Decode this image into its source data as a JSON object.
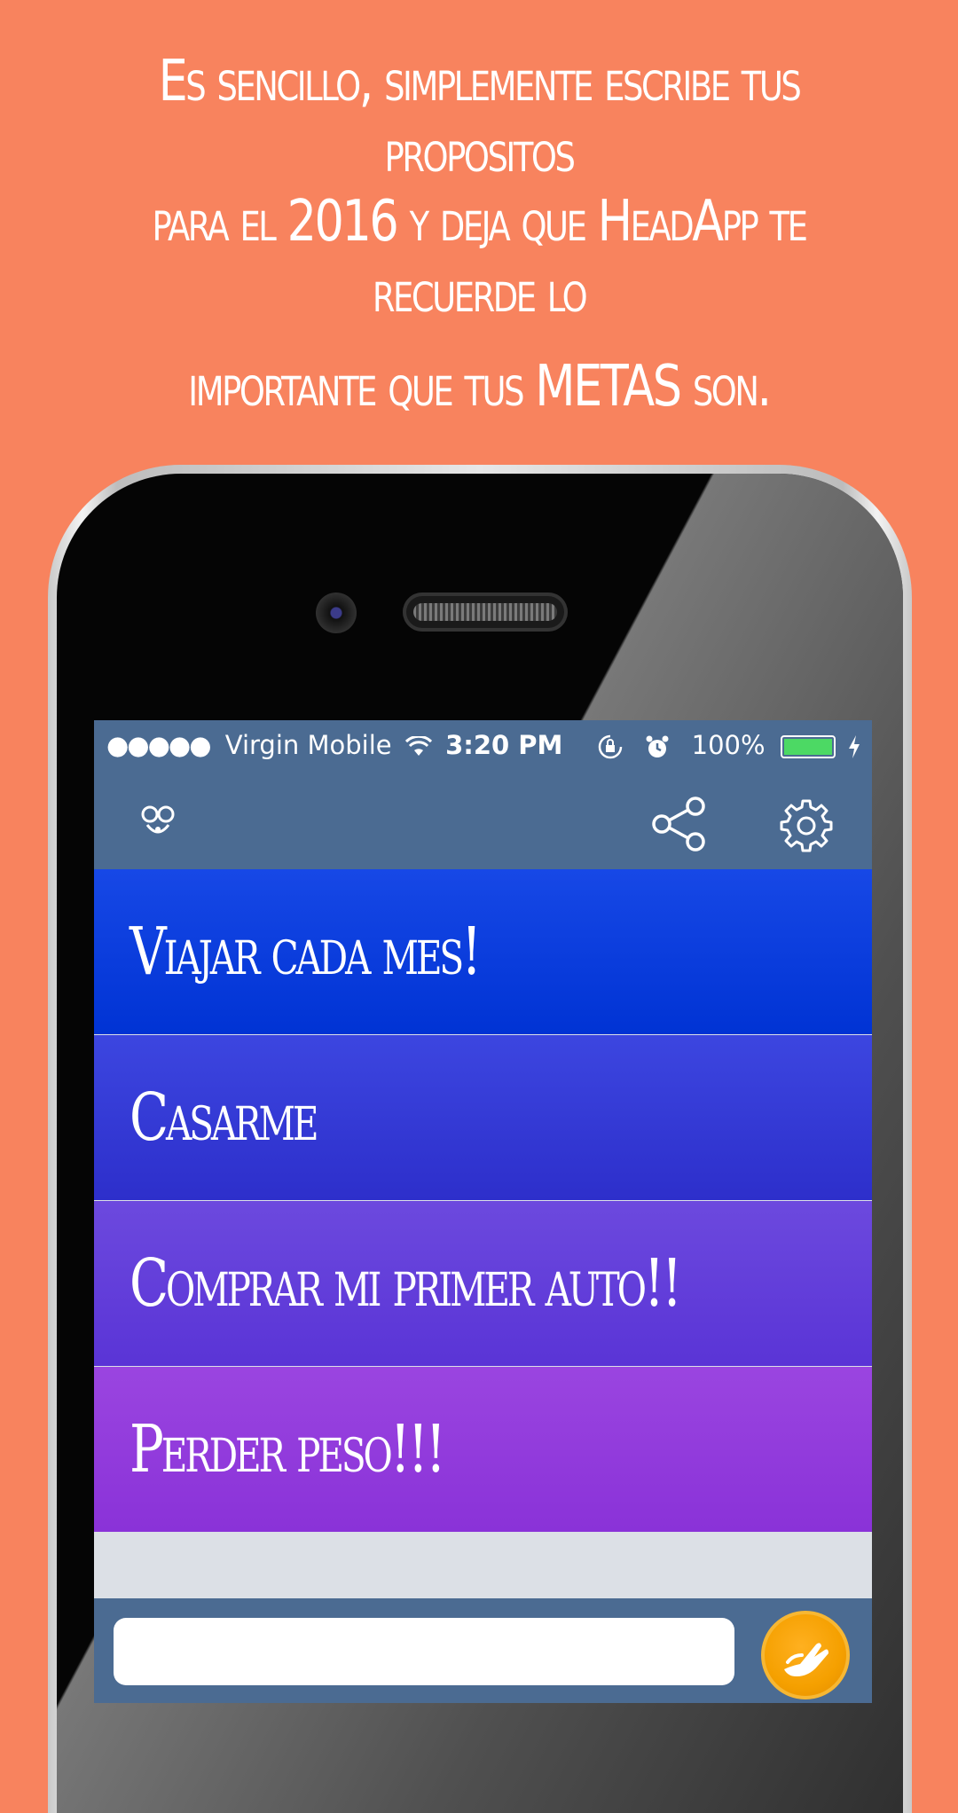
{
  "headline": {
    "line1": "Es sencillo, simplemente escribe tus propositos",
    "line2": "para el 2016 y deja que  HeadApp te recuerde lo",
    "line3": "importante que tus METAS son."
  },
  "status_bar": {
    "signal": "●●●●●",
    "carrier": "Virgin Mobile",
    "time": "3:20 PM",
    "battery": "100%",
    "battery_level": 1.0,
    "icons": [
      "wifi-icon",
      "rotation-lock-icon",
      "alarm-icon",
      "battery-icon",
      "charging-bolt-icon"
    ]
  },
  "nav_bar": {
    "icons": [
      "app-logo-icon",
      "share-icon",
      "settings-gear-icon"
    ]
  },
  "goals": [
    {
      "label": "Viajar cada mes!"
    },
    {
      "label": "Casarme"
    },
    {
      "label": "Comprar mi primer auto!!"
    },
    {
      "label": "Perder peso!!!"
    }
  ],
  "composer": {
    "input_value": "",
    "send_icon": "hand-wave-icon"
  },
  "colors": {
    "background": "#F8835E",
    "bar": "#4B6B92",
    "goal1": "#0033D4",
    "goal2": "#2D2FCB",
    "goal3": "#5A34D6",
    "goal4": "#8A32D8",
    "send_button": "#F5A000"
  }
}
